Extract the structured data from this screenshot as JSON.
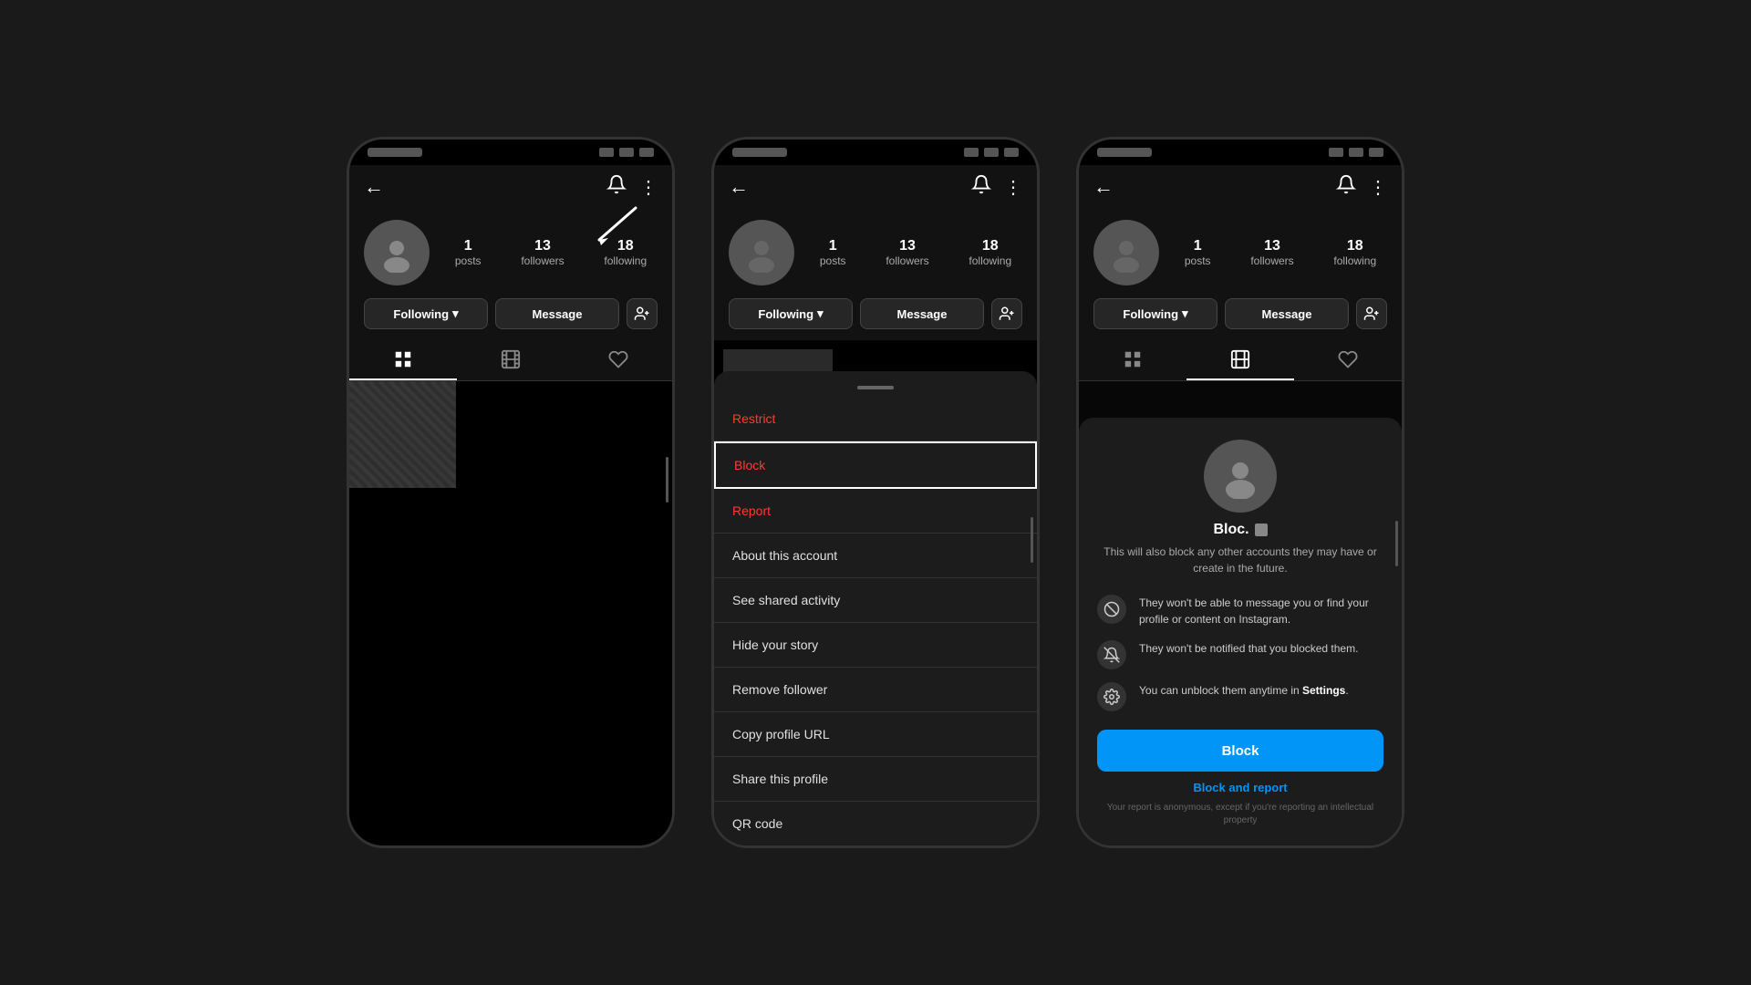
{
  "phones": {
    "phone1": {
      "nav": {
        "back": "←",
        "username": "",
        "bell_icon": "🔔",
        "more_icon": "⋮"
      },
      "profile": {
        "stats": [
          {
            "number": "1",
            "label": "posts"
          },
          {
            "number": "13",
            "label": "followers"
          },
          {
            "number": "18",
            "label": "following"
          }
        ],
        "buttons": {
          "following": "Following",
          "message": "Message"
        }
      },
      "arrow_note": "Points to more menu icon"
    },
    "phone2": {
      "nav": {
        "stats": [
          {
            "number": "1",
            "label": "posts"
          },
          {
            "number": "13",
            "label": "followers"
          },
          {
            "number": "18",
            "label": "following"
          }
        ],
        "buttons": {
          "following": "Following",
          "message": "Message"
        }
      },
      "sheet": {
        "items": [
          {
            "id": "restrict",
            "label": "Restrict",
            "color": "red"
          },
          {
            "id": "block",
            "label": "Block",
            "color": "red",
            "highlighted": true
          },
          {
            "id": "report",
            "label": "Report",
            "color": "red"
          },
          {
            "id": "about",
            "label": "About this account",
            "color": "normal"
          },
          {
            "id": "shared",
            "label": "See shared activity",
            "color": "normal"
          },
          {
            "id": "hide_story",
            "label": "Hide your story",
            "color": "normal"
          },
          {
            "id": "remove_follower",
            "label": "Remove follower",
            "color": "normal"
          },
          {
            "id": "copy_url",
            "label": "Copy profile URL",
            "color": "normal"
          },
          {
            "id": "share_profile",
            "label": "Share this profile",
            "color": "normal"
          },
          {
            "id": "qr_code",
            "label": "QR code",
            "color": "normal"
          }
        ]
      }
    },
    "phone3": {
      "nav": {
        "stats": [
          {
            "number": "1",
            "label": "posts"
          },
          {
            "number": "13",
            "label": "followers"
          },
          {
            "number": "18",
            "label": "following"
          }
        ],
        "buttons": {
          "following": "Following",
          "message": "Message"
        }
      },
      "confirm": {
        "username": "Bloc.",
        "subtitle": "This will also block any other accounts they may have or create in the future.",
        "info_items": [
          {
            "icon": "🚫",
            "text": "They won't be able to message you or find your profile or content on Instagram."
          },
          {
            "icon": "🔕",
            "text": "They won't be notified that you blocked them."
          },
          {
            "icon": "⚙",
            "text_before": "You can unblock them anytime in ",
            "highlight": "Settings",
            "text_after": "."
          }
        ],
        "block_button": "Block",
        "block_report_button": "Block and report",
        "disclaimer": "Your report is anonymous, except if you're reporting an intellectual property"
      }
    }
  }
}
